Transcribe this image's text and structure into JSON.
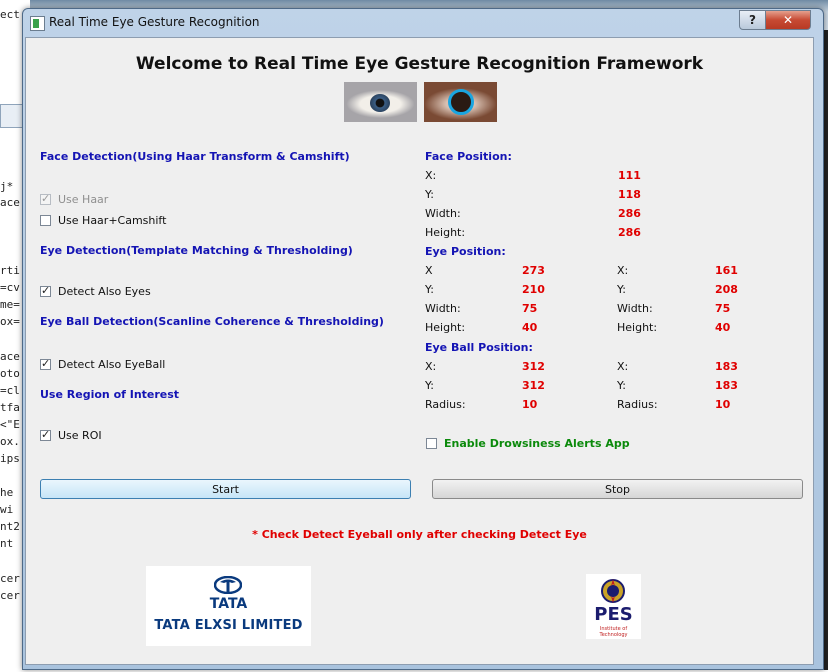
{
  "window": {
    "title": "Real Time Eye Gesture Recognition",
    "help_label": "?",
    "close_label": "✕"
  },
  "background_code": [
    "ect",
    "j*",
    "ace",
    "rti",
    "=cv",
    "me=",
    "ox=",
    "ace",
    "oto",
    "=cl",
    "tfa",
    "<\"E",
    "ox.",
    "ips",
    "he",
    "wi",
    "nt2",
    "nt",
    "cer",
    "cer"
  ],
  "main": {
    "heading": "Welcome to Real Time Eye Gesture Recognition Framework"
  },
  "face_detection": {
    "title": "Face Detection(Using Haar Transform & Camshift)",
    "use_haar": {
      "label": "Use Haar",
      "checked": true,
      "enabled": false
    },
    "use_haar_camshift": {
      "label": "Use Haar+Camshift",
      "checked": false
    }
  },
  "eye_detection": {
    "title": "Eye Detection(Template Matching & Thresholding)",
    "detect_eyes": {
      "label": "Detect Also Eyes",
      "checked": true
    }
  },
  "eyeball_detection": {
    "title": "Eye Ball Detection(Scanline Coherence & Thresholding)",
    "detect_eyeball": {
      "label": "Detect Also EyeBall",
      "checked": true
    }
  },
  "roi": {
    "title": "Use Region of Interest",
    "use_roi": {
      "label": "Use ROI",
      "checked": true
    }
  },
  "face_position": {
    "title": "Face Position:",
    "x_label": "X:",
    "x": "111",
    "y_label": "Y:",
    "y": "118",
    "width_label": "Width:",
    "width": "286",
    "height_label": "Height:",
    "height": "286"
  },
  "eye_position": {
    "title": "Eye Position:",
    "left": {
      "x_label": "X",
      "x": "273",
      "y_label": "Y:",
      "y": "210",
      "width_label": "Width:",
      "width": "75",
      "height_label": "Height:",
      "height": "40"
    },
    "right": {
      "x_label": "X:",
      "x": "161",
      "y_label": "Y:",
      "y": "208",
      "width_label": "Width:",
      "width": "75",
      "height_label": "Height:",
      "height": "40"
    }
  },
  "eyeball_position": {
    "title": "Eye Ball Position:",
    "left": {
      "x_label": "X:",
      "x": "312",
      "y_label": "Y:",
      "y": "312",
      "radius_label": "Radius:",
      "radius": "10"
    },
    "right": {
      "x_label": "X:",
      "x": "183",
      "y_label": "Y:",
      "y": "183",
      "radius_label": "Radius:",
      "radius": "10"
    }
  },
  "drowsiness": {
    "label": "Enable Drowsiness Alerts App",
    "checked": false
  },
  "buttons": {
    "start_label": "Start",
    "stop_label": "Stop"
  },
  "note": "* Check Detect Eyeball only after checking Detect Eye",
  "logos": {
    "tata_word": "TATA",
    "tata_name": "TATA ELXSI LIMITED",
    "pes_word": "PES",
    "pes_sub": "Institute of Technology"
  },
  "colors": {
    "section_title": "#1414b4",
    "value_red": "#e00000",
    "drowsy_green": "#0b8a0b"
  }
}
